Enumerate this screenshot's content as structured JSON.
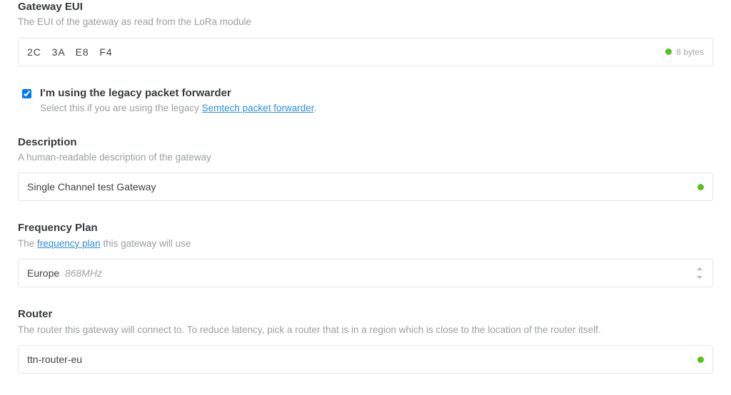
{
  "gateway_eui": {
    "label": "Gateway EUI",
    "sub": "The EUI of the gateway as read from the LoRa module",
    "value": "2C   3A   E8   F4",
    "bytes": "8 bytes"
  },
  "legacy": {
    "label": "I'm using the legacy packet forwarder",
    "sub_prefix": "Select this if you are using the legacy ",
    "link_text": "Semtech packet forwarder",
    "sub_suffix": ".",
    "checked": true
  },
  "description": {
    "label": "Description",
    "sub": "A human-readable description of the gateway",
    "value": "Single Channel test Gateway"
  },
  "frequency": {
    "label": "Frequency Plan",
    "sub_prefix": "The ",
    "link_text": "frequency plan",
    "sub_suffix": " this gateway will use",
    "value_region": "Europe",
    "value_freq": "868MHz"
  },
  "router": {
    "label": "Router",
    "sub": "The router this gateway will connect to. To reduce latency, pick a router that is in a region which is close to the location of the router itself.",
    "value": "ttn-router-eu"
  }
}
